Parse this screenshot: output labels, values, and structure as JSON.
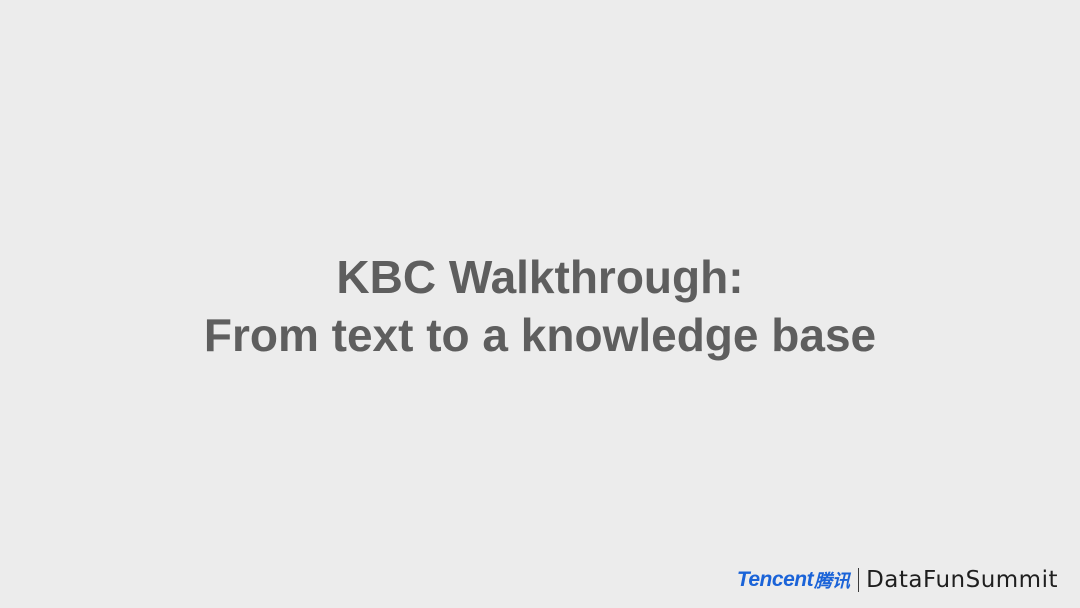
{
  "slide": {
    "title_line_1": "KBC Walkthrough:",
    "title_line_2": "From text to a knowledge base"
  },
  "footer": {
    "tencent_text": "Tencent",
    "tencent_cn_text": "腾讯",
    "summit_text": "DataFunSummit"
  },
  "colors": {
    "background": "#ececec",
    "title_text": "#5e5e5e",
    "tencent_blue": "#1a63d8",
    "summit_text": "#1f1f1f"
  }
}
